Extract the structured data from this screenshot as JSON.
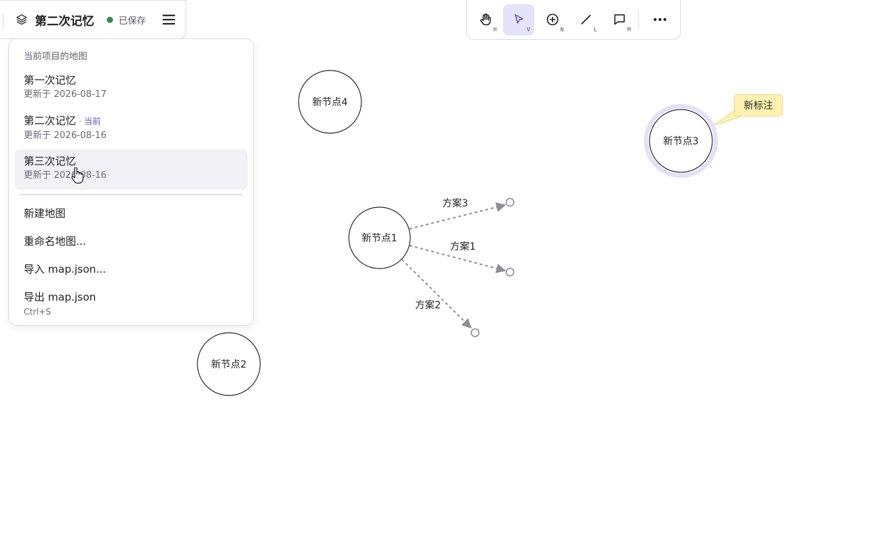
{
  "titlebar": {
    "layers_icon": "layers-icon",
    "title": "第二次记忆",
    "save_status": "已保存",
    "save_color": "#2f8f4e",
    "menu_icon": "hamburger-menu-icon"
  },
  "dropdown": {
    "section_title": "当前项目的地图",
    "maps": [
      {
        "name": "第一次记忆",
        "date": "更新于 2026-08-17",
        "current_label": ""
      },
      {
        "name": "第二次记忆",
        "date": "更新于 2026-08-16",
        "current_label": "当前"
      },
      {
        "name": "第三次记忆",
        "date": "更新于 2026-08-16",
        "current_label": ""
      }
    ],
    "actions": [
      {
        "label": "新建地图",
        "shortcut": ""
      },
      {
        "label": "重命名地图...",
        "shortcut": ""
      },
      {
        "label": "导入 map.json...",
        "shortcut": ""
      },
      {
        "label": "导出 map.json",
        "shortcut": "Ctrl+S"
      }
    ]
  },
  "toolbar": {
    "tools": [
      {
        "icon": "hand-icon",
        "key": "H",
        "active": false
      },
      {
        "icon": "pointer-icon",
        "key": "V",
        "active": true
      },
      {
        "icon": "add-node-icon",
        "key": "N",
        "active": false
      },
      {
        "icon": "link-icon",
        "key": "L",
        "active": false
      },
      {
        "icon": "comment-icon",
        "key": "M",
        "active": false
      }
    ],
    "more_icon": "more-icon",
    "accent": "#e5e3fa"
  },
  "canvas": {
    "nodes": [
      {
        "id": "n4",
        "label": "新节点4"
      },
      {
        "id": "n3",
        "label": "新节点3",
        "selected": true
      },
      {
        "id": "n1",
        "label": "新节点1"
      },
      {
        "id": "n2",
        "label": "新节点2"
      }
    ],
    "edges": [
      {
        "label": "方案3"
      },
      {
        "label": "方案1"
      },
      {
        "label": "方案2"
      }
    ],
    "note": {
      "text": "新标注"
    },
    "selection_color": "#e2e0fa",
    "edge_color": "#8e8e96"
  }
}
